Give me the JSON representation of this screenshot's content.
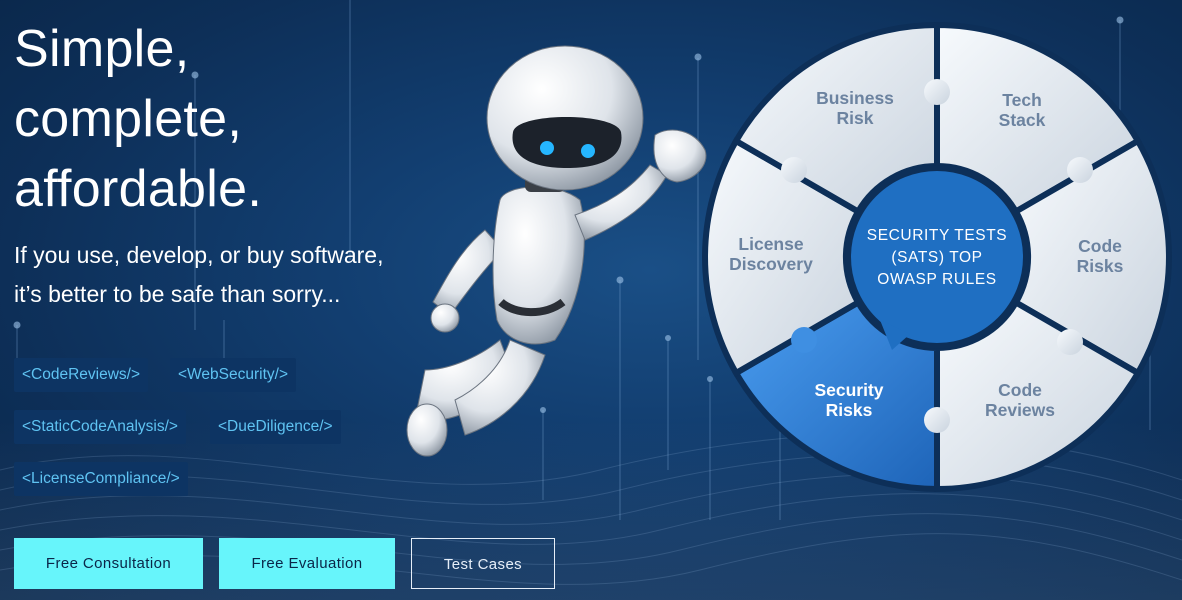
{
  "hero": {
    "headline": "Simple,\ncomplete,\naffordable.",
    "subtitle": "If you use, develop, or buy software,\nit’s better to be safe than sorry..."
  },
  "tags": [
    "<CodeReviews/>",
    "<WebSecurity/>",
    "<StaticCodeAnalysis/>",
    "<DueDiligence/>",
    "<LicenseCompliance/>"
  ],
  "buttons": {
    "consultation": "Free Consultation",
    "evaluation": "Free Evaluation",
    "test_cases": "Test Cases"
  },
  "wheel": {
    "center": [
      "SECURITY TESTS",
      "(SATS) TOP",
      "OWASP RULES"
    ],
    "segments": {
      "business_risk": [
        "Business",
        "Risk"
      ],
      "tech_stack": [
        "Tech",
        "Stack"
      ],
      "code_risks": [
        "Code",
        "Risks"
      ],
      "code_reviews": [
        "Code",
        "Reviews"
      ],
      "security_risks": [
        "Security",
        "Risks"
      ],
      "license_discovery": [
        "License",
        "Discovery"
      ]
    },
    "active_segment": "security_risks"
  },
  "colors": {
    "background": "#123e70",
    "accent_button": "#67f5fb",
    "tag_text": "#5fc3f2",
    "active_segment": "#2f86d8",
    "center_circle": "#1f6fc2"
  }
}
